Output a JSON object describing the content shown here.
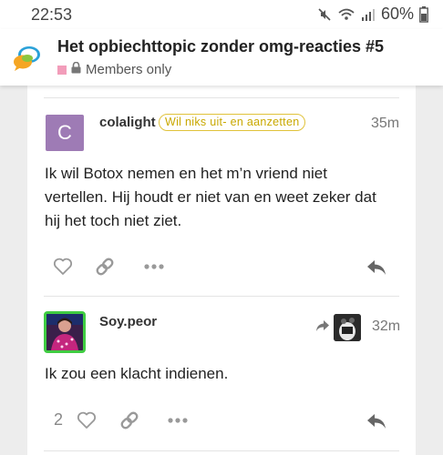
{
  "status_bar": {
    "time": "22:53",
    "battery": "60%",
    "icons": [
      "mute-icon",
      "wifi-icon",
      "signal-icon",
      "battery-icon"
    ]
  },
  "topic": {
    "title": "Het opbiechttopic zonder omg-reacties #5",
    "category_label": "Members only",
    "category_color": "#f29dba"
  },
  "posts": [
    {
      "username": "colalight",
      "avatar_letter": "C",
      "avatar_color": "#9e7bb5",
      "user_title": "Wil niks uit- en aanzetten",
      "time_ago": "35m",
      "lines": [
        "Ik wil Botox nemen en het m’n vriend niet",
        "vertellen. Hij houdt er niet van en weet zeker dat",
        "hij het toch niet ziet."
      ],
      "likes": ""
    },
    {
      "username": "Soy.peor",
      "time_ago": "32m",
      "lines": [
        "Ik zou een klacht indienen."
      ],
      "likes": "2"
    }
  ],
  "colors": {
    "badge": "#e0c23a",
    "avatar_border": "#3fcc42",
    "icon_gray": "#999999"
  }
}
